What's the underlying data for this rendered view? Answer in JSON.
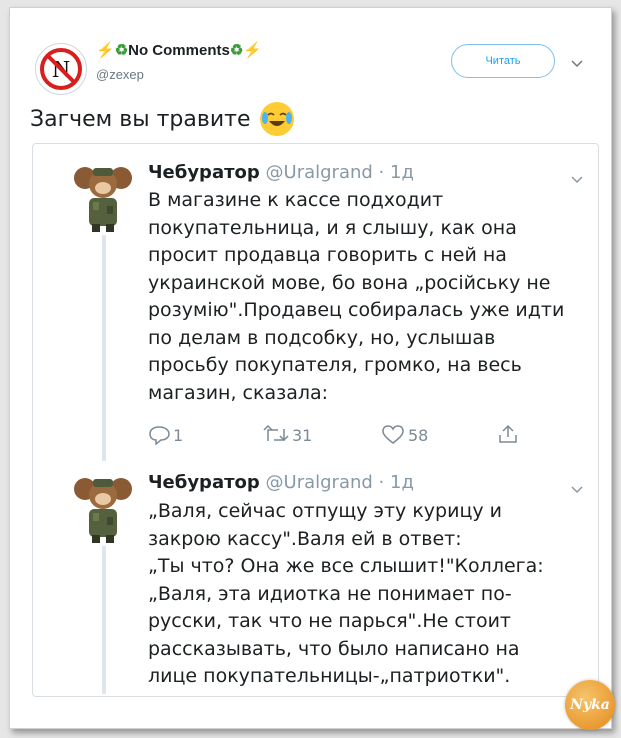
{
  "header": {
    "account_name": "No Comments",
    "handle": "@zexep",
    "follow_label": "Читать"
  },
  "tweet": {
    "text": "Загчем вы травите"
  },
  "quoted_tweets": [
    {
      "name": "Чебуратор",
      "handle": "@Uralgrand",
      "time": "· 1д",
      "lines": [
        "В магазине к кассе подходит",
        "покупательница, и я слышу, как она",
        "просит продавца говорить с ней на",
        "украинской мове, бо вона „російську не",
        "розумію\".Продавец собиралась уже идти",
        "по делам в подсобку, но, услышав",
        "просьбу покупателя, громко, на весь",
        "магазин, сказала:"
      ],
      "actions": {
        "replies": "1",
        "retweets": "31",
        "likes": "58"
      }
    },
    {
      "name": "Чебуратор",
      "handle": "@Uralgrand",
      "time": "· 1д",
      "lines": [
        "„Валя, сейчас отпущу эту курицу и",
        "закрою кассу\".Валя ей в ответ:",
        "„Ты что? Она же все слышит!\"Коллега:",
        "„Валя, эта идиотка не понимает по-",
        "русски, так что не парься\".Не стоит",
        "рассказывать, что было написано на",
        "лице покупательницы-„патриотки\"."
      ]
    }
  ],
  "colors": {
    "accent": "#1da1f2",
    "text": "#1c2022",
    "muted": "#8899a6"
  }
}
